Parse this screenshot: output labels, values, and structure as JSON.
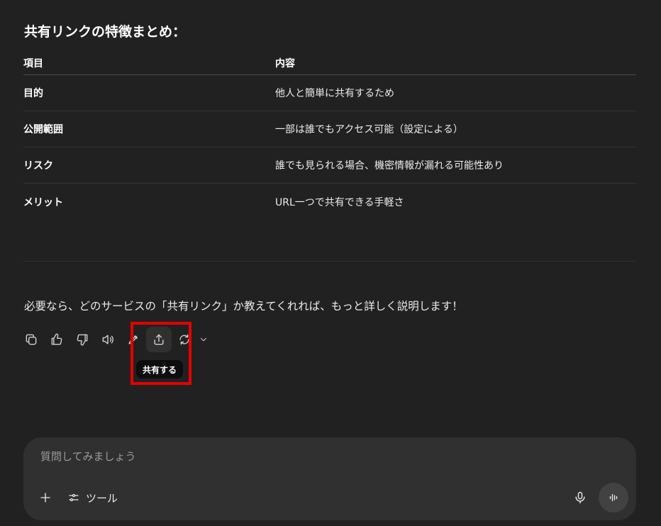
{
  "section_title": "共有リンクの特徴まとめ：",
  "table": {
    "headers": [
      "項目",
      "内容"
    ],
    "rows": [
      [
        "目的",
        "他人と簡単に共有するため"
      ],
      [
        "公開範囲",
        "一部は誰でもアクセス可能（設定による）"
      ],
      [
        "リスク",
        "誰でも見られる場合、機密情報が漏れる可能性あり"
      ],
      [
        "メリット",
        "URL一つで共有できる手軽さ"
      ]
    ]
  },
  "followup_text": "必要なら、どのサービスの「共有リンク」か教えてくれれば、もっと詳しく説明します！",
  "actions": {
    "icons": [
      "copy-icon",
      "thumbs-up-icon",
      "thumbs-down-icon",
      "speaker-icon",
      "edit-icon",
      "share-icon",
      "regenerate-icon",
      "chevron-down-icon"
    ],
    "tooltip": "共有する"
  },
  "composer": {
    "placeholder": "質問してみましょう",
    "tools_label": "ツール"
  },
  "colors": {
    "background": "#212121",
    "composer": "#303030",
    "highlight": "#e60000",
    "tooltip_bg": "#0d0d0d"
  }
}
